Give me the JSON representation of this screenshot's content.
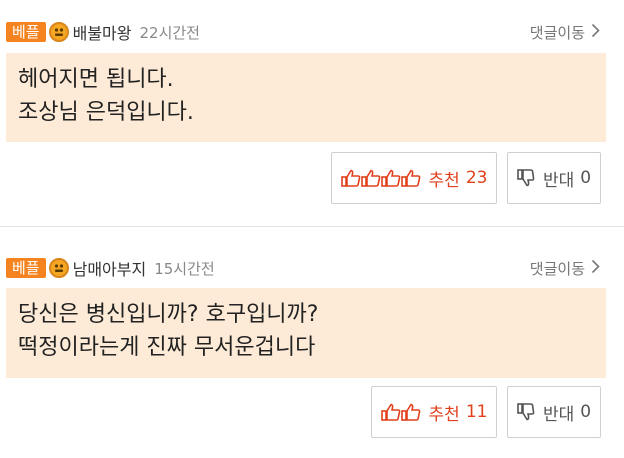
{
  "comments": [
    {
      "badge": "베플",
      "nickname": "배불마왕",
      "time": "22시간전",
      "move_label": "댓글이동",
      "lines": [
        "헤어지면 됩니다.",
        "조상님 은덕입니다."
      ],
      "recommend_label": "추천",
      "recommend_count": "23",
      "oppose_label": "반대",
      "oppose_count": "0",
      "thumb_icons": 4
    },
    {
      "badge": "베플",
      "nickname": "남매아부지",
      "time": "15시간전",
      "move_label": "댓글이동",
      "lines": [
        "당신은 병신입니까? 호구입니까?",
        "떡정이라는게 진짜 무서운겁니다"
      ],
      "recommend_label": "추천",
      "recommend_count": "11",
      "oppose_label": "반대",
      "oppose_count": "0",
      "thumb_icons": 2
    }
  ],
  "colors": {
    "badge": "#f5831f",
    "comment_bg": "#fdebd7",
    "recommend": "#e2401c"
  },
  "icons": {
    "level": "level-face-icon",
    "chevron": "chevron-right-icon",
    "thumbs_up": "thumbs-up-icon",
    "thumbs_down": "thumbs-down-icon"
  }
}
